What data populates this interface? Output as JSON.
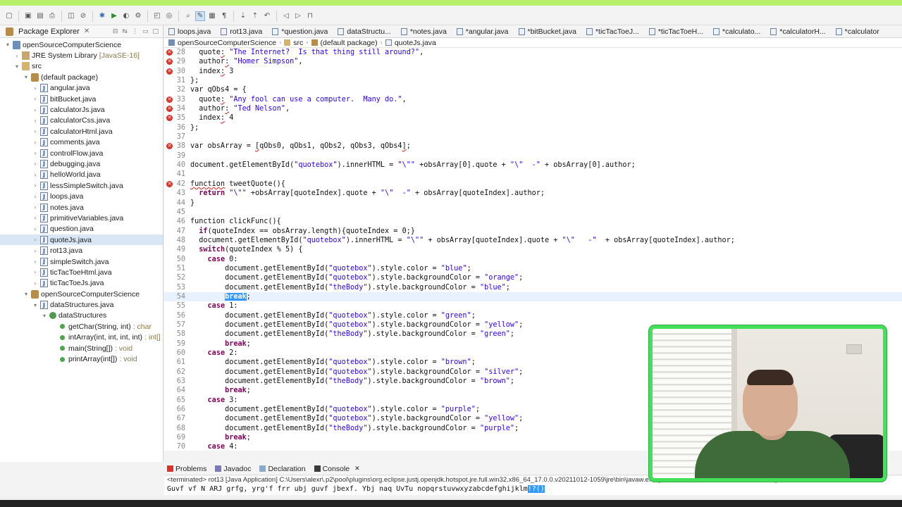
{
  "toolbar": {
    "buttons": [
      "new-icon",
      "save-icon",
      "save-all-icon",
      "print-icon",
      "open-type-icon",
      "skip-breakpoints-icon",
      "debug-icon",
      "run-icon",
      "coverage-icon",
      "external-tools-icon",
      "new-java-project-icon",
      "new-class-icon",
      "search-icon",
      "toggle-mark-occurrences-icon",
      "toggle-block-selection-icon",
      "show-whitespace-icon",
      "next-annotation-icon",
      "previous-annotation-icon",
      "last-edit-icon",
      "back-icon",
      "forward-icon",
      "pin-editor-icon"
    ]
  },
  "package_explorer": {
    "title": "Package Explorer",
    "items": [
      {
        "label": "openSourceComputerScience",
        "type": "",
        "indent": 0,
        "icon": "project",
        "tw": "▾"
      },
      {
        "label": "JRE System Library",
        "type": "[JavaSE-16]",
        "indent": 1,
        "icon": "lib",
        "tw": "›"
      },
      {
        "label": "src",
        "type": "",
        "indent": 1,
        "icon": "src",
        "tw": "▾"
      },
      {
        "label": "(default package)",
        "type": "",
        "indent": 2,
        "icon": "pkg",
        "tw": "▾"
      },
      {
        "label": "angular.java",
        "type": "",
        "indent": 3,
        "icon": "java",
        "tw": "›"
      },
      {
        "label": "bitBucket.java",
        "type": "",
        "indent": 3,
        "icon": "java",
        "tw": "›"
      },
      {
        "label": "calculatorJs.java",
        "type": "",
        "indent": 3,
        "icon": "java",
        "tw": "›"
      },
      {
        "label": "calculatorCss.java",
        "type": "",
        "indent": 3,
        "icon": "java",
        "tw": "›"
      },
      {
        "label": "calculatorHtml.java",
        "type": "",
        "indent": 3,
        "icon": "java",
        "tw": "›"
      },
      {
        "label": "comments.java",
        "type": "",
        "indent": 3,
        "icon": "java",
        "tw": "›"
      },
      {
        "label": "controlFlow.java",
        "type": "",
        "indent": 3,
        "icon": "java",
        "tw": "›"
      },
      {
        "label": "debugging.java",
        "type": "",
        "indent": 3,
        "icon": "java",
        "tw": "›"
      },
      {
        "label": "helloWorld.java",
        "type": "",
        "indent": 3,
        "icon": "java",
        "tw": "›"
      },
      {
        "label": "lessSimpleSwitch.java",
        "type": "",
        "indent": 3,
        "icon": "java",
        "tw": "›"
      },
      {
        "label": "loops.java",
        "type": "",
        "indent": 3,
        "icon": "java",
        "tw": "›"
      },
      {
        "label": "notes.java",
        "type": "",
        "indent": 3,
        "icon": "java",
        "tw": "›"
      },
      {
        "label": "primitiveVariables.java",
        "type": "",
        "indent": 3,
        "icon": "java",
        "tw": "›"
      },
      {
        "label": "question.java",
        "type": "",
        "indent": 3,
        "icon": "java",
        "tw": "›"
      },
      {
        "label": "quoteJs.java",
        "type": "",
        "indent": 3,
        "icon": "java",
        "tw": "›",
        "selected": true
      },
      {
        "label": "rot13.java",
        "type": "",
        "indent": 3,
        "icon": "java",
        "tw": "›"
      },
      {
        "label": "simpleSwitch.java",
        "type": "",
        "indent": 3,
        "icon": "java",
        "tw": "›"
      },
      {
        "label": "ticTacToeHtml.java",
        "type": "",
        "indent": 3,
        "icon": "java",
        "tw": "›"
      },
      {
        "label": "ticTacToeJs.java",
        "type": "",
        "indent": 3,
        "icon": "java",
        "tw": "›"
      },
      {
        "label": "openSourceComputerScience",
        "type": "",
        "indent": 2,
        "icon": "pkg",
        "tw": "▾"
      },
      {
        "label": "dataStructures.java",
        "type": "",
        "indent": 3,
        "icon": "java",
        "tw": "▾"
      },
      {
        "label": "dataStructures",
        "type": "",
        "indent": 4,
        "icon": "class",
        "tw": "▾"
      },
      {
        "label": "getChar(String, int)",
        "type": ": char",
        "indent": 5,
        "icon": "method",
        "tw": ""
      },
      {
        "label": "intArray(int, int, int, int)",
        "type": ": int[]",
        "indent": 5,
        "icon": "method",
        "tw": ""
      },
      {
        "label": "main(String[])",
        "type": ": void",
        "indent": 5,
        "icon": "method",
        "tw": ""
      },
      {
        "label": "printArray(int[])",
        "type": ": void",
        "indent": 5,
        "icon": "method",
        "tw": ""
      }
    ]
  },
  "editor_tabs": [
    {
      "label": "loops.java",
      "active": false
    },
    {
      "label": "rot13.java",
      "active": false
    },
    {
      "label": "*question.java",
      "active": false
    },
    {
      "label": "dataStructu...",
      "active": false
    },
    {
      "label": "*notes.java",
      "active": false
    },
    {
      "label": "*angular.java",
      "active": false
    },
    {
      "label": "*bitBucket.java",
      "active": false
    },
    {
      "label": "*ticTacToeJ...",
      "active": false
    },
    {
      "label": "*ticTacToeH...",
      "active": false
    },
    {
      "label": "*calculato...",
      "active": false
    },
    {
      "label": "*calculatorH...",
      "active": false
    },
    {
      "label": "*calculator",
      "active": false
    }
  ],
  "breadcrumb": [
    "openSourceComputerScience",
    "src",
    "(default package)",
    "quoteJs.java"
  ],
  "code_lines": [
    {
      "n": "28",
      "err": true,
      "hl": false,
      "html": "  quote<span class=\"squig\">:</span> <span class=\"str\">\"The Internet?  Is that thing still around?\"</span>,"
    },
    {
      "n": "29",
      "err": true,
      "hl": false,
      "html": "  author<span class=\"squig\">:</span> <span class=\"str\">\"Homer Simpson\"</span>,"
    },
    {
      "n": "30",
      "err": true,
      "hl": false,
      "html": "  index<span class=\"squig\">:</span> 3"
    },
    {
      "n": "31",
      "err": false,
      "hl": false,
      "html": "};"
    },
    {
      "n": "32",
      "err": false,
      "hl": false,
      "html": "var qObs4 = {"
    },
    {
      "n": "33",
      "err": true,
      "hl": false,
      "html": "  quote<span class=\"squig\">:</span> <span class=\"str\">\"Any fool can use a computer.  Many do.\"</span>,"
    },
    {
      "n": "34",
      "err": true,
      "hl": false,
      "html": "  author<span class=\"squig\">:</span> <span class=\"str\">\"Ted Nelson\"</span>,"
    },
    {
      "n": "35",
      "err": true,
      "hl": false,
      "html": "  index<span class=\"squig\">:</span> 4"
    },
    {
      "n": "36",
      "err": false,
      "hl": false,
      "html": "};"
    },
    {
      "n": "37",
      "err": false,
      "hl": false,
      "html": ""
    },
    {
      "n": "38",
      "err": true,
      "hl": false,
      "html": "var obsArray = <span class=\"squig\">[</span>qObs0, qObs1, qObs2, qObs3, qObs4<span class=\"squig\">]</span>;"
    },
    {
      "n": "39",
      "err": false,
      "hl": false,
      "html": ""
    },
    {
      "n": "40",
      "err": false,
      "hl": false,
      "html": "document.getElementById(<span class=\"str\">\"quotebox\"</span>).innerHTML = <span class=\"str\">\"\\\"\"</span> +obsArray[0].quote + <span class=\"str\">\"\\\"  -\"</span> + obsArray[0].author;"
    },
    {
      "n": "41",
      "err": false,
      "hl": false,
      "html": ""
    },
    {
      "n": "42",
      "err": true,
      "hl": false,
      "html": "<span class=\"squig\">function</span> tweetQuote(){"
    },
    {
      "n": "43",
      "err": false,
      "hl": false,
      "html": "  <span class=\"kw\">return</span> <span class=\"str\">\"\\\"\"</span> +obsArray[quoteIndex].quote + <span class=\"str\">\"\\\"  -\"</span> + obsArray[quoteIndex].author;"
    },
    {
      "n": "44",
      "err": false,
      "hl": false,
      "html": "}"
    },
    {
      "n": "45",
      "err": false,
      "hl": false,
      "html": ""
    },
    {
      "n": "46",
      "err": false,
      "hl": false,
      "html": "function clickFunc(){"
    },
    {
      "n": "47",
      "err": false,
      "hl": false,
      "html": "  <span class=\"kw\">if</span>(quoteIndex == obsArray.length){quoteIndex = 0;}"
    },
    {
      "n": "48",
      "err": false,
      "hl": false,
      "html": "  document.getElementById(<span class=\"str\">\"quotebox\"</span>).innerHTML = <span class=\"str\">\"\\\"\"</span> + obsArray[quoteIndex].quote + <span class=\"str\">\"\\\"   -\"</span>  + obsArray[quoteIndex].author;"
    },
    {
      "n": "49",
      "err": false,
      "hl": false,
      "html": "  <span class=\"kw\">switch</span>(quoteIndex % 5) {"
    },
    {
      "n": "50",
      "err": false,
      "hl": false,
      "html": "    <span class=\"kw\">case</span> 0:"
    },
    {
      "n": "51",
      "err": false,
      "hl": false,
      "html": "        document.getElementById(<span class=\"str\">\"quotebox\"</span>).style.color = <span class=\"str\">\"blue\"</span>;"
    },
    {
      "n": "52",
      "err": false,
      "hl": false,
      "html": "        document.getElementById(<span class=\"str\">\"quotebox\"</span>).style.backgroundColor = <span class=\"str\">\"orange\"</span>;"
    },
    {
      "n": "53",
      "err": false,
      "hl": false,
      "html": "        document.getElementById(<span class=\"str\">\"theBody\"</span>).style.backgroundColor = <span class=\"str\">\"blue\"</span>;"
    },
    {
      "n": "54",
      "err": false,
      "hl": true,
      "html": "        <span class=\"selword\">break</span>;"
    },
    {
      "n": "55",
      "err": false,
      "hl": false,
      "html": "    <span class=\"kw\">case</span> 1:"
    },
    {
      "n": "56",
      "err": false,
      "hl": false,
      "html": "        document.getElementById(<span class=\"str\">\"quotebox\"</span>).style.color = <span class=\"str\">\"green\"</span>;"
    },
    {
      "n": "57",
      "err": false,
      "hl": false,
      "html": "        document.getElementById(<span class=\"str\">\"quotebox\"</span>).style.backgroundColor = <span class=\"str\">\"yellow\"</span>;"
    },
    {
      "n": "58",
      "err": false,
      "hl": false,
      "html": "        document.getElementById(<span class=\"str\">\"theBody\"</span>).style.backgroundColor = <span class=\"str\">\"green\"</span>;"
    },
    {
      "n": "59",
      "err": false,
      "hl": false,
      "html": "        <span class=\"kw\">break</span>;"
    },
    {
      "n": "60",
      "err": false,
      "hl": false,
      "html": "    <span class=\"kw\">case</span> 2:"
    },
    {
      "n": "61",
      "err": false,
      "hl": false,
      "html": "        document.getElementById(<span class=\"str\">\"quotebox\"</span>).style.color = <span class=\"str\">\"brown\"</span>;"
    },
    {
      "n": "62",
      "err": false,
      "hl": false,
      "html": "        document.getElementById(<span class=\"str\">\"quotebox\"</span>).style.backgroundColor = <span class=\"str\">\"silver\"</span>;"
    },
    {
      "n": "63",
      "err": false,
      "hl": false,
      "html": "        document.getElementById(<span class=\"str\">\"theBody\"</span>).style.backgroundColor = <span class=\"str\">\"brown\"</span>;"
    },
    {
      "n": "64",
      "err": false,
      "hl": false,
      "html": "        <span class=\"kw\">break</span>;"
    },
    {
      "n": "65",
      "err": false,
      "hl": false,
      "html": "    <span class=\"kw\">case</span> 3:"
    },
    {
      "n": "66",
      "err": false,
      "hl": false,
      "html": "        document.getElementById(<span class=\"str\">\"quotebox\"</span>).style.color = <span class=\"str\">\"purple\"</span>;"
    },
    {
      "n": "67",
      "err": false,
      "hl": false,
      "html": "        document.getElementById(<span class=\"str\">\"quotebox\"</span>).style.backgroundColor = <span class=\"str\">\"yellow\"</span>;"
    },
    {
      "n": "68",
      "err": false,
      "hl": false,
      "html": "        document.getElementById(<span class=\"str\">\"theBody\"</span>).style.backgroundColor = <span class=\"str\">\"purple\"</span>;"
    },
    {
      "n": "69",
      "err": false,
      "hl": false,
      "html": "        <span class=\"kw\">break</span>;"
    },
    {
      "n": "70",
      "err": false,
      "hl": false,
      "html": "    <span class=\"kw\">case</span> 4:"
    }
  ],
  "bottom_tabs": [
    "Problems",
    "Javadoc",
    "Declaration",
    "Console"
  ],
  "console": {
    "header": "<terminated> rot13 [Java Application] C:\\Users\\alexr\\.p2\\pool\\plugins\\org.eclipse.justj.openjdk.hotspot.jre.full.win32.x86_64_17.0.0.v20211012-1059\\jre\\bin\\javaw.exe  (Feb 8, 2022, 1:15:36 PM – 1:15:36 PM)",
    "output": "Guvf vf N ARJ grfg, yrg'f frr ubj guvf jbexf. Ybj naq UvTu nopqrstuvwxyzabcdefghijklm",
    "output_selected": "!?()"
  },
  "colors": {
    "accent_green": "#43e05a",
    "keyword": "#7f0055",
    "string": "#2a00ff",
    "selection": "#3399ff",
    "error": "#d9342b"
  }
}
